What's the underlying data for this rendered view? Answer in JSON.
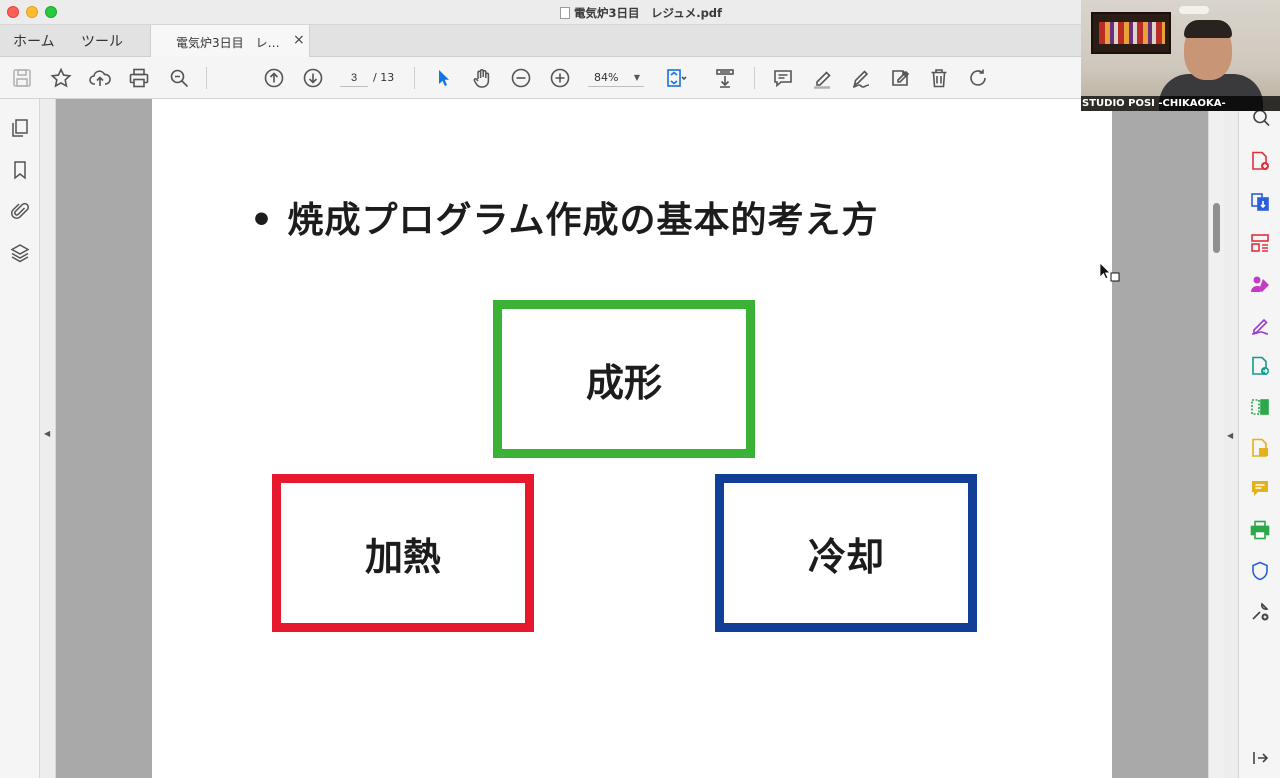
{
  "window": {
    "title": "電気炉3日目　レジュメ.pdf"
  },
  "tabs": {
    "home": "ホーム",
    "tools": "ツール",
    "document": "電気炉3日目　レ…",
    "close": "×"
  },
  "toolbar": {
    "current_page": "3",
    "total_pages": "/ 13",
    "zoom": "84%",
    "icons": [
      "save-icon",
      "star-icon",
      "upload-icon",
      "print-icon",
      "zoom-search-icon",
      "page-up-icon",
      "page-down-icon",
      "select-arrow-icon",
      "hand-icon",
      "zoom-out-icon",
      "zoom-in-icon",
      "fit-page-icon",
      "scroll-mode-icon",
      "comment-icon",
      "highlight-icon",
      "sign-icon",
      "stamp-icon",
      "delete-icon",
      "rotate-icon"
    ]
  },
  "left_rail": {
    "icons": [
      "page-thumbnails-icon",
      "bookmark-icon",
      "attachment-icon",
      "layers-icon"
    ]
  },
  "right_rail": {
    "icons": [
      "search-icon",
      "export-pdf-icon",
      "create-pdf-icon",
      "organize-pages-icon",
      "share-icon",
      "edit-pdf-icon",
      "send-for-review-icon",
      "compare-icon",
      "scan-icon",
      "comment-panel-icon",
      "print-production-icon",
      "protect-icon",
      "more-tools-icon",
      "collapse-panel-icon"
    ],
    "colors": [
      "#444444",
      "#e0313f",
      "#2b5fd9",
      "#e0313f",
      "#c43ac4",
      "#9b3cd0",
      "#149c8c",
      "#2aa84a",
      "#e3b21a",
      "#e3b21a",
      "#2aa84a",
      "#2b5fd9",
      "#444444",
      "#444444"
    ]
  },
  "slide": {
    "title": "• 焼成プログラム作成の基本的考え方",
    "boxes": {
      "forming": {
        "label": "成形",
        "color": "#3bb135"
      },
      "heating": {
        "label": "加熱",
        "color": "#e5182e"
      },
      "cooling": {
        "label": "冷却",
        "color": "#103f95"
      }
    }
  },
  "webcam": {
    "label": "STUDIO POSI -CHIKAOKA-"
  },
  "colors": {
    "accent_blue": "#1473e6"
  }
}
